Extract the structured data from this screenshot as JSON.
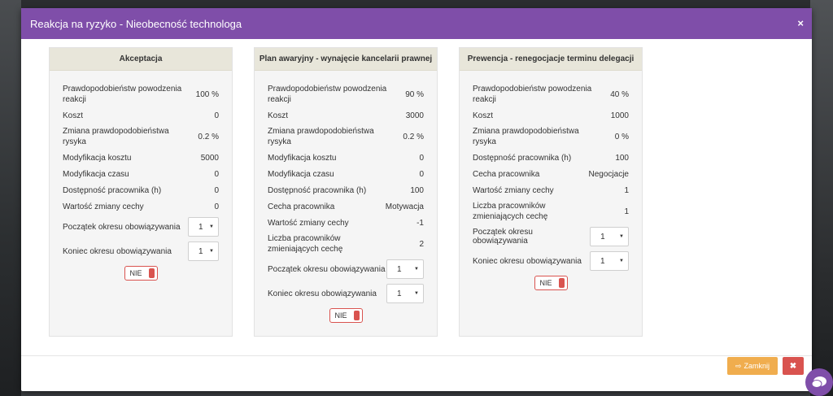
{
  "modal": {
    "title": "Reakcja na ryzyko - Nieobecność technologa",
    "close_symbol": "×"
  },
  "panels": [
    {
      "header": "Akceptacja",
      "rows": [
        {
          "label": "Prawdopodobieństw powodzenia reakcji",
          "value": "100 %"
        },
        {
          "label": "Koszt",
          "value": "0"
        },
        {
          "label": "Zmiana prawdopodobieństwa rysyka",
          "value": "0.2 %"
        },
        {
          "label": "Modyfikacja kosztu",
          "value": "5000"
        },
        {
          "label": "Modyfikacja czasu",
          "value": "0"
        },
        {
          "label": "Dostępność pracownika (h)",
          "value": "0"
        },
        {
          "label": "Wartość zmiany cechy",
          "value": "0"
        }
      ],
      "selects": [
        {
          "label": "Początek okresu obowiązywania",
          "value": "1"
        },
        {
          "label": "Koniec okresu obowiązywania",
          "value": "1"
        }
      ],
      "toggle": "NIE"
    },
    {
      "header": "Plan awaryjny - wynajęcie kancelarii prawnej",
      "rows": [
        {
          "label": "Prawdopodobieństw powodzenia reakcji",
          "value": "90 %"
        },
        {
          "label": "Koszt",
          "value": "3000"
        },
        {
          "label": "Zmiana prawdopodobieństwa rysyka",
          "value": "0.2 %"
        },
        {
          "label": "Modyfikacja kosztu",
          "value": "0"
        },
        {
          "label": "Modyfikacja czasu",
          "value": "0"
        },
        {
          "label": "Dostępność pracownika (h)",
          "value": "100"
        },
        {
          "label": "Cecha pracownika",
          "value": "Motywacja"
        },
        {
          "label": "Wartość zmiany cechy",
          "value": "-1"
        },
        {
          "label": "Liczba pracowników zmieniających cechę",
          "value": "2"
        }
      ],
      "selects": [
        {
          "label": "Początek okresu obowiązywania",
          "value": "1"
        },
        {
          "label": "Koniec okresu obowiązywania",
          "value": "1"
        }
      ],
      "toggle": "NIE"
    },
    {
      "header": "Prewencja - renegocjacje terminu delegacji",
      "rows": [
        {
          "label": "Prawdopodobieństw powodzenia reakcji",
          "value": "40 %"
        },
        {
          "label": "Koszt",
          "value": "1000"
        },
        {
          "label": "Zmiana prawdopodobieństwa rysyka",
          "value": "0 %"
        },
        {
          "label": "Dostępność pracownika (h)",
          "value": "100"
        },
        {
          "label": "Cecha pracownika",
          "value": "Negocjacje"
        },
        {
          "label": "Wartość zmiany cechy",
          "value": "1"
        },
        {
          "label": "Liczba pracowników zmieniających cechę",
          "value": "1"
        }
      ],
      "selects": [
        {
          "label": "Początek okresu obowiązywania",
          "value": "1"
        },
        {
          "label": "Koniec okresu obowiązywania",
          "value": "1"
        }
      ],
      "toggle": "NIE"
    }
  ],
  "footer": {
    "close_label": "Zamknij",
    "close_icon": "sign-out-icon",
    "dismiss_symbol": "✖"
  },
  "colors": {
    "header": "#7f4ea9",
    "panel_header": "#e8e6da",
    "warning": "#f0ad4e",
    "danger": "#d9534f"
  },
  "icons": {
    "chat": "chat-bubble-icon"
  }
}
